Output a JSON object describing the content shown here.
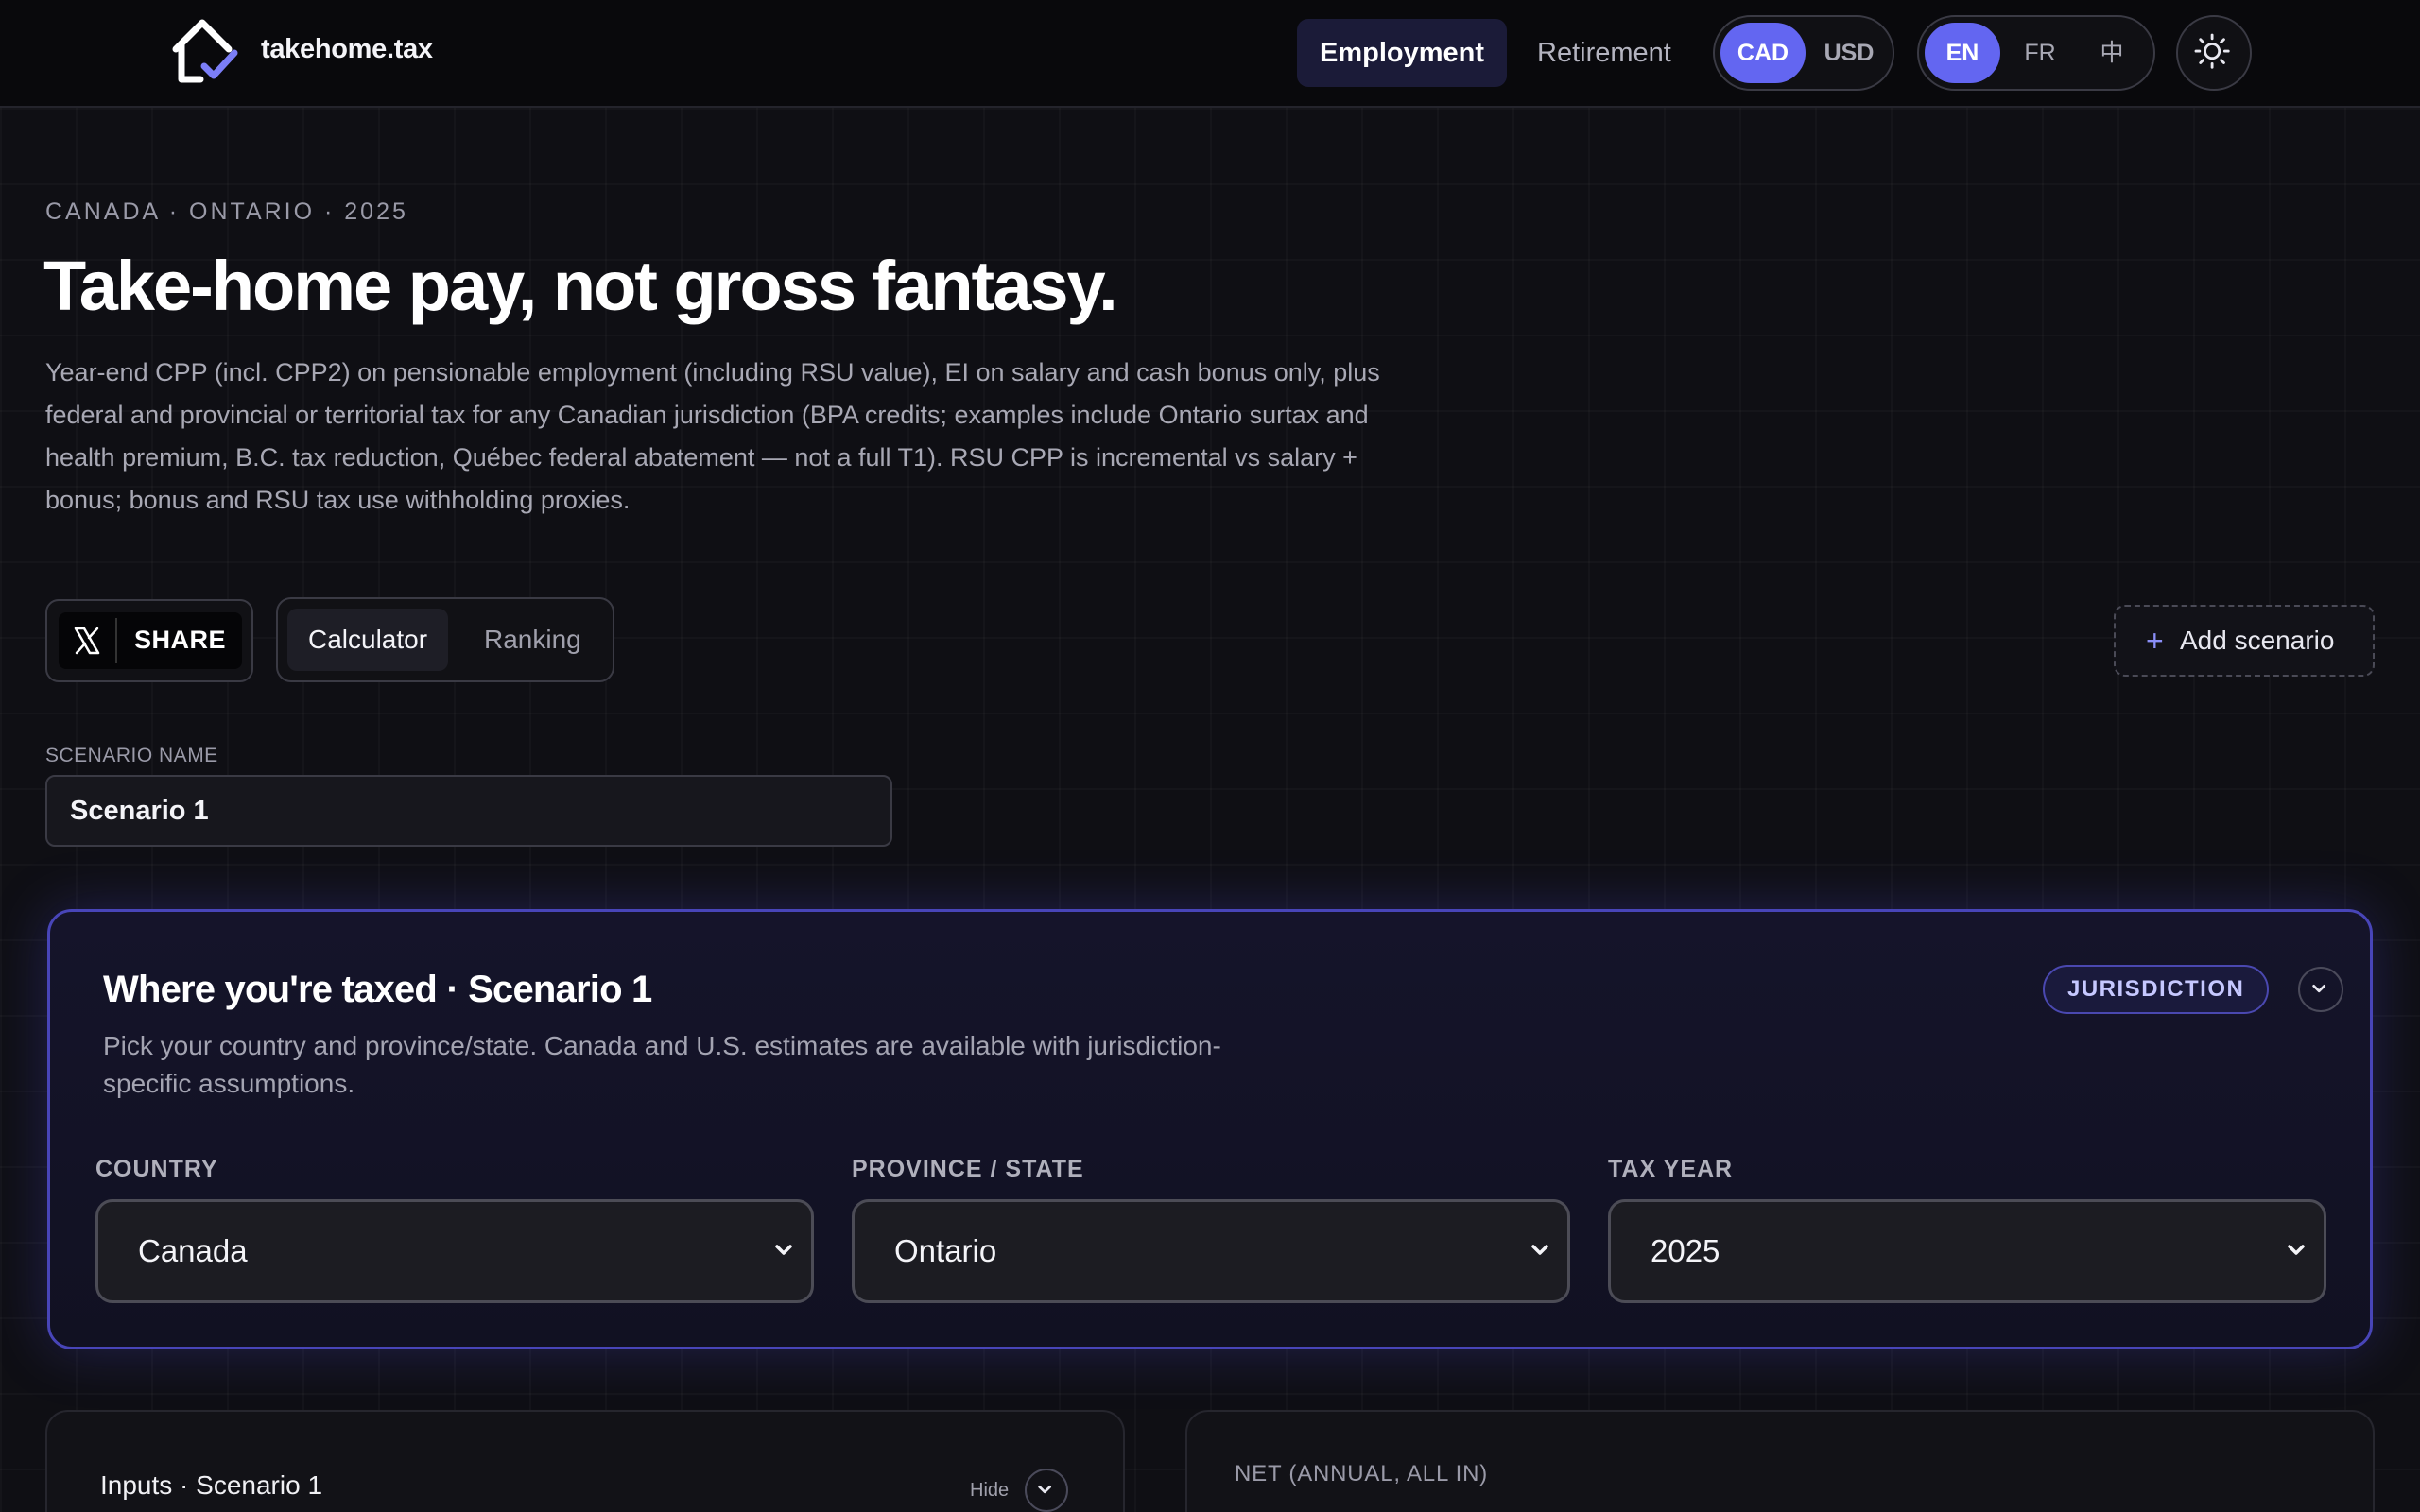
{
  "nav": {
    "brand": "takehome.tax",
    "tabs": [
      {
        "label": "Employment",
        "active": true
      },
      {
        "label": "Retirement",
        "active": false
      }
    ],
    "currency": {
      "options": [
        "CAD",
        "USD"
      ],
      "selected": "CAD"
    },
    "language": {
      "options": [
        "EN",
        "FR",
        "中"
      ],
      "selected": "EN"
    },
    "theme_icon": "sun-icon"
  },
  "hero": {
    "eyebrow": "CANADA · ONTARIO · 2025",
    "title": "Take-home pay, not gross fantasy.",
    "description": "Year-end CPP (incl. CPP2) on pensionable employment (including RSU value), EI on salary and cash bonus only, plus federal and provincial or territorial tax for any Canadian jurisdiction (BPA credits; examples include Ontario surtax and health premium, B.C. tax reduction, Québec federal abatement — not a full T1). RSU CPP is incremental vs salary + bonus; bonus and RSU tax use withholding proxies."
  },
  "actions": {
    "share_label": "SHARE",
    "view_tabs": [
      {
        "label": "Calculator",
        "active": true
      },
      {
        "label": "Ranking",
        "active": false
      }
    ],
    "add_scenario": "Add scenario"
  },
  "scenario": {
    "name_label": "SCENARIO NAME",
    "name_value": "Scenario 1"
  },
  "jurisdiction": {
    "title": "Where you're taxed · Scenario 1",
    "description": "Pick your country and province/state. Canada and U.S. estimates are available with jurisdiction-specific assumptions.",
    "badge": "JURISDICTION",
    "country_label": "COUNTRY",
    "country_value": "Canada",
    "province_label": "PROVINCE / STATE",
    "province_value": "Ontario",
    "year_label": "TAX YEAR",
    "year_value": "2025"
  },
  "inputs_panel": {
    "title": "Inputs · Scenario 1",
    "hide_label": "Hide"
  },
  "net_panel": {
    "label": "NET (ANNUAL, ALL IN)"
  },
  "colors": {
    "accent": "#6366f1",
    "background": "#0f0f14",
    "card_border": "#4845b8"
  }
}
